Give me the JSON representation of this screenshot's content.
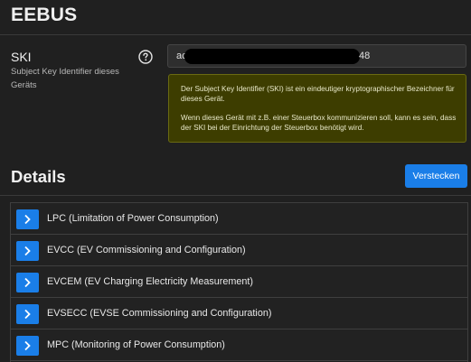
{
  "page": {
    "title": "EEBUS"
  },
  "ski": {
    "label": "SKI",
    "sublabel": "Subject Key Identifier dieses Geräts",
    "value_prefix": "ac",
    "value_suffix": "48",
    "info_paragraph_1": "Der Subject Key Identifier (SKI) ist ein eindeutiger kryptographischer Bezeichner für dieses Gerät.",
    "info_paragraph_2": "Wenn dieses Gerät mit z.B. einer Steuerbox kommunizieren soll, kann es sein, dass der SKI bei der Einrichtung der Steuerbox benötigt wird."
  },
  "details": {
    "heading": "Details",
    "hide_label": "Verstecken",
    "items": [
      {
        "label": "LPC (Limitation of Power Consumption)"
      },
      {
        "label": "EVCC (EV Commissioning and Configuration)"
      },
      {
        "label": "EVCEM (EV Charging Electricity Measurement)"
      },
      {
        "label": "EVSECC (EVSE Commissioning and Configuration)"
      },
      {
        "label": "MPC (Monitoring of Power Consumption)"
      }
    ]
  },
  "icons": {
    "help": "question-circle-icon",
    "expand": "chevron-right-icon"
  },
  "colors": {
    "accent": "#1a7ee8",
    "info_bg": "#3d3d00",
    "background": "#202020"
  }
}
